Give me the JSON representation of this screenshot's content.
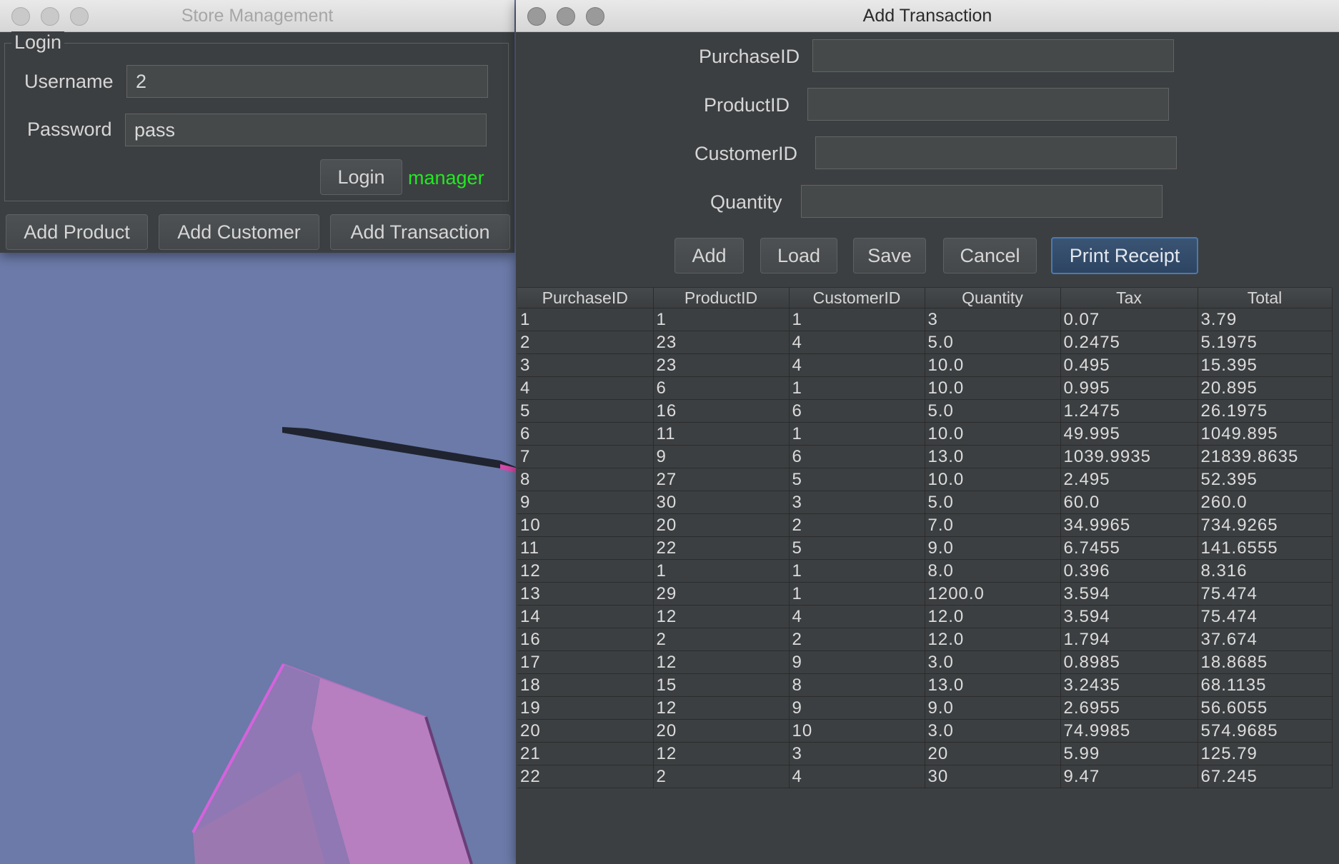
{
  "store_window": {
    "title": "Store Management",
    "login_group_title": "Login",
    "username_label": "Username",
    "username_value": "2",
    "password_label": "Password",
    "password_value": "pass",
    "login_button": "Login",
    "role_text": "manager",
    "role_color": "#22e922",
    "buttons": [
      "Add Product",
      "Add Customer",
      "Add Transaction"
    ]
  },
  "txn_window": {
    "title": "Add Transaction",
    "fields": [
      {
        "label": "PurchaseID",
        "value": ""
      },
      {
        "label": "ProductID",
        "value": ""
      },
      {
        "label": "CustomerID",
        "value": ""
      },
      {
        "label": "Quantity",
        "value": ""
      }
    ],
    "buttons": {
      "add": "Add",
      "load": "Load",
      "save": "Save",
      "cancel": "Cancel",
      "print_receipt": "Print Receipt"
    },
    "table": {
      "headers": [
        "PurchaseID",
        "ProductID",
        "CustomerID",
        "Quantity",
        "Tax",
        "Total"
      ],
      "rows": [
        [
          "1",
          "1",
          "1",
          "3",
          "0.07",
          "3.79"
        ],
        [
          "2",
          "23",
          "4",
          "5.0",
          "0.2475",
          "5.1975"
        ],
        [
          "3",
          "23",
          "4",
          "10.0",
          "0.495",
          "15.395"
        ],
        [
          "4",
          "6",
          "1",
          "10.0",
          "0.995",
          "20.895"
        ],
        [
          "5",
          "16",
          "6",
          "5.0",
          "1.2475",
          "26.1975"
        ],
        [
          "6",
          "11",
          "1",
          "10.0",
          "49.995",
          "1049.895"
        ],
        [
          "7",
          "9",
          "6",
          "13.0",
          "1039.9935",
          "21839.8635"
        ],
        [
          "8",
          "27",
          "5",
          "10.0",
          "2.495",
          "52.395"
        ],
        [
          "9",
          "30",
          "3",
          "5.0",
          "60.0",
          "260.0"
        ],
        [
          "10",
          "20",
          "2",
          "7.0",
          "34.9965",
          "734.9265"
        ],
        [
          "11",
          "22",
          "5",
          "9.0",
          "6.7455",
          "141.6555"
        ],
        [
          "12",
          "1",
          "1",
          "8.0",
          "0.396",
          "8.316"
        ],
        [
          "13",
          "29",
          "1",
          "1200.0",
          "3.594",
          "75.474"
        ],
        [
          "14",
          "12",
          "4",
          "12.0",
          "3.594",
          "75.474"
        ],
        [
          "16",
          "2",
          "2",
          "12.0",
          "1.794",
          "37.674"
        ],
        [
          "17",
          "12",
          "9",
          "3.0",
          "0.8985",
          "18.8685"
        ],
        [
          "18",
          "15",
          "8",
          "13.0",
          "3.2435",
          "68.1135"
        ],
        [
          "19",
          "12",
          "9",
          "9.0",
          "2.6955",
          "56.6055"
        ],
        [
          "20",
          "20",
          "10",
          "3.0",
          "74.9985",
          "574.9685"
        ],
        [
          "21",
          "12",
          "3",
          "20",
          "5.99",
          "125.79"
        ],
        [
          "22",
          "2",
          "4",
          "30",
          "9.47",
          "67.245"
        ]
      ]
    }
  },
  "colors": {
    "scene_background": "#6b7aa8",
    "window_background": "#3c3f41",
    "primary_button_border": "#4a7ab1"
  }
}
